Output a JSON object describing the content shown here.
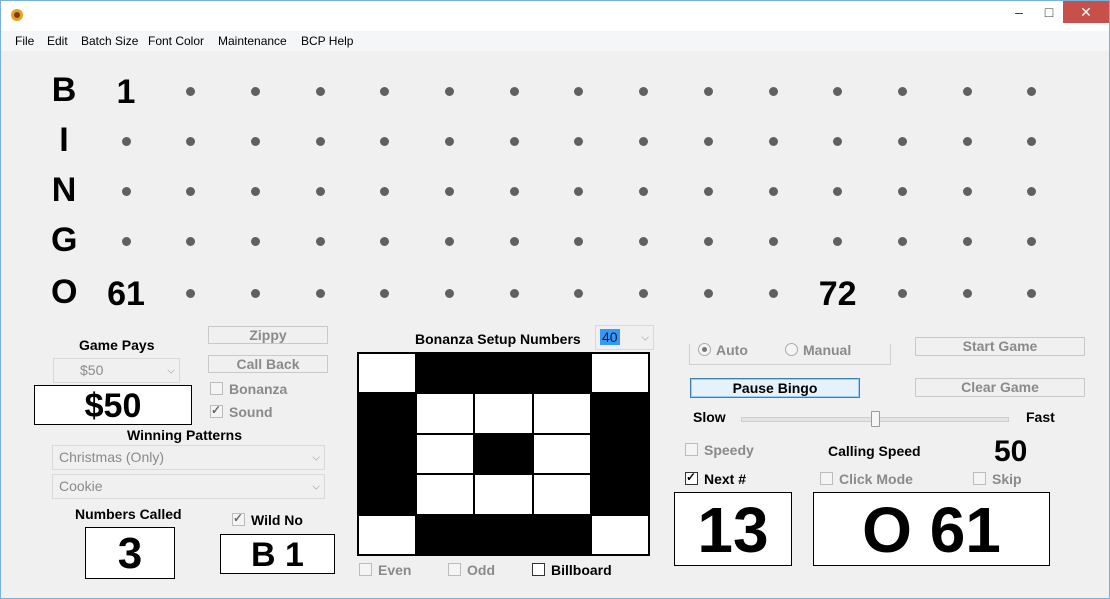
{
  "menu": [
    "File",
    "Edit",
    "Batch Size",
    "Font Color",
    "Maintenance",
    "BCP Help"
  ],
  "window_controls": {
    "minimize": "–",
    "maximize": "□",
    "close": "✕"
  },
  "board": {
    "letters": [
      "B",
      "I",
      "N",
      "G",
      "O"
    ],
    "rows": [
      [
        "1",
        "",
        "",
        "",
        "",
        "",
        "",
        "",
        "",
        "",
        "",
        "",
        "",
        "",
        ""
      ],
      [
        "",
        "",
        "",
        "",
        "",
        "",
        "",
        "",
        "",
        "",
        "",
        "",
        "",
        "",
        ""
      ],
      [
        "",
        "",
        "",
        "",
        "",
        "",
        "",
        "",
        "",
        "",
        "",
        "",
        "",
        "",
        ""
      ],
      [
        "",
        "",
        "",
        "",
        "",
        "",
        "",
        "",
        "",
        "",
        "",
        "",
        "",
        "",
        ""
      ],
      [
        "61",
        "",
        "",
        "",
        "",
        "",
        "",
        "",
        "",
        "",
        "",
        "72",
        "",
        "",
        ""
      ]
    ]
  },
  "left_panel": {
    "game_pays_label": "Game Pays",
    "game_pays_select": "$50",
    "game_pays_display": "$50",
    "zippy_label": "Zippy",
    "call_back_label": "Call Back",
    "bonanza_label": "Bonanza",
    "sound_label": "Sound",
    "winning_patterns_label": "Winning Patterns",
    "pattern_1": "Christmas (Only)",
    "pattern_2": "Cookie",
    "numbers_called_label": "Numbers Called",
    "numbers_called_value": "3",
    "wild_no_label": "Wild No",
    "wild_no_value": "B 1"
  },
  "bonanza": {
    "title": "Bonanza Setup Numbers",
    "select_value": "40",
    "even_label": "Even",
    "odd_label": "Odd",
    "billboard_label": "Billboard",
    "pattern": [
      [
        0,
        1,
        1,
        1,
        0
      ],
      [
        1,
        0,
        0,
        0,
        1
      ],
      [
        1,
        0,
        1,
        0,
        1
      ],
      [
        1,
        0,
        0,
        0,
        1
      ],
      [
        0,
        1,
        1,
        1,
        0
      ]
    ]
  },
  "right_panel": {
    "auto_label": "Auto",
    "manual_label": "Manual",
    "start_game_label": "Start Game",
    "pause_bingo_label": "Pause Bingo",
    "clear_game_label": "Clear Game",
    "slow_label": "Slow",
    "fast_label": "Fast",
    "speedy_label": "Speedy",
    "calling_speed_label": "Calling Speed",
    "calling_speed_value": "50",
    "next_label": "Next #",
    "click_mode_label": "Click Mode",
    "skip_label": "Skip",
    "next_number_display": "13",
    "current_call_display": "O 61"
  }
}
